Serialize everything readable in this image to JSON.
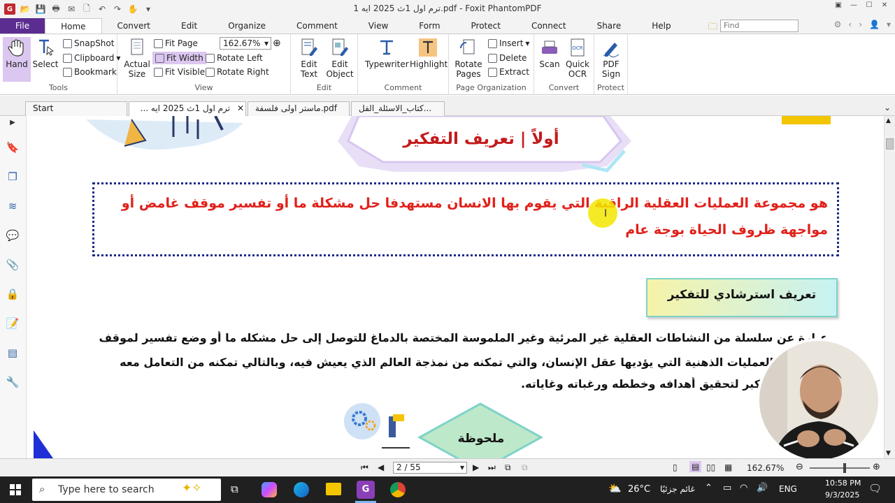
{
  "window": {
    "title": "ترم اول 1ث 2025 ايه 1.pdf - Foxit PhantomPDF"
  },
  "menu": [
    "File",
    "Home",
    "Convert",
    "Edit",
    "Organize",
    "Comment",
    "View",
    "Form",
    "Protect",
    "Connect",
    "Share",
    "Help"
  ],
  "search_placeholder": "Find",
  "ribbon": {
    "hand": "Hand",
    "select": "Select",
    "snapshot": "SnapShot",
    "clipboard": "Clipboard",
    "bookmark": "Bookmark",
    "tools": "Tools",
    "actual_size": "Actual Size",
    "fit_page": "Fit Page",
    "fit_width": "Fit Width",
    "fit_visible": "Fit Visible",
    "zoom": "162.67%",
    "rotate_left": "Rotate Left",
    "rotate_right": "Rotate Right",
    "view": "View",
    "edit_text": "Edit Text",
    "edit_object": "Edit Object",
    "edit": "Edit",
    "typewriter": "Typewriter",
    "highlight": "Highlight",
    "comment": "Comment",
    "rotate_pages": "Rotate Pages",
    "insert": "Insert",
    "delete": "Delete",
    "extract": "Extract",
    "page_org": "Page Organization",
    "scan": "Scan",
    "quick_ocr": "Quick OCR",
    "convert": "Convert",
    "pdf_sign": "PDF Sign",
    "protect": "Protect"
  },
  "tabs": [
    "Start",
    "ترم اول 1ث 2025 ايه ...",
    "ماستر اولى فلسفة.pdf",
    "كتاب_الاسئلة_الفل..."
  ],
  "doc": {
    "heading": "أولاً | تعريف التفكير",
    "definition": "هو مجموعة العمليات العقلية الراقية التي يقوم بها الانسان مستهدفا حل مشكلة ما أو تفسير موقف غامض أو مواجهة ظروف الحياة بوجة عام",
    "guide_title": "تعريف استرشادي للتفكير",
    "p1": "عبارة عن سلسلة من النشاطات العقلية غير المرئية وغير الملموسة المختصة بالدماغ للتوصل إلى حل مشكله ما أو وضع تفسير لموقف غامض .",
    "p2": "الأشكال والعمليات الذهنية التي يؤديها عقل الإنسان، والتي تمكنه من نمذجة العالم الذي يعيش فيه، وبالتالي تمكنه من التعامل معه",
    "p3": "بكبر لتحقيق أهدافه وخططه ورغباته وغاياته.",
    "note": "ملحوظة"
  },
  "status": {
    "page": "2 / 55",
    "zoom": "162.67%"
  },
  "taskbar": {
    "search": "Type here to search",
    "temp": "26°C",
    "weather": "غائم جزئيًا",
    "lang": "ENG",
    "time": "10:58 PM",
    "date": "9/3/2025"
  },
  "colors": {
    "file_purple": "#5c2d91",
    "red_text": "#e0211a",
    "highlight_yellow": "#f3e600"
  }
}
